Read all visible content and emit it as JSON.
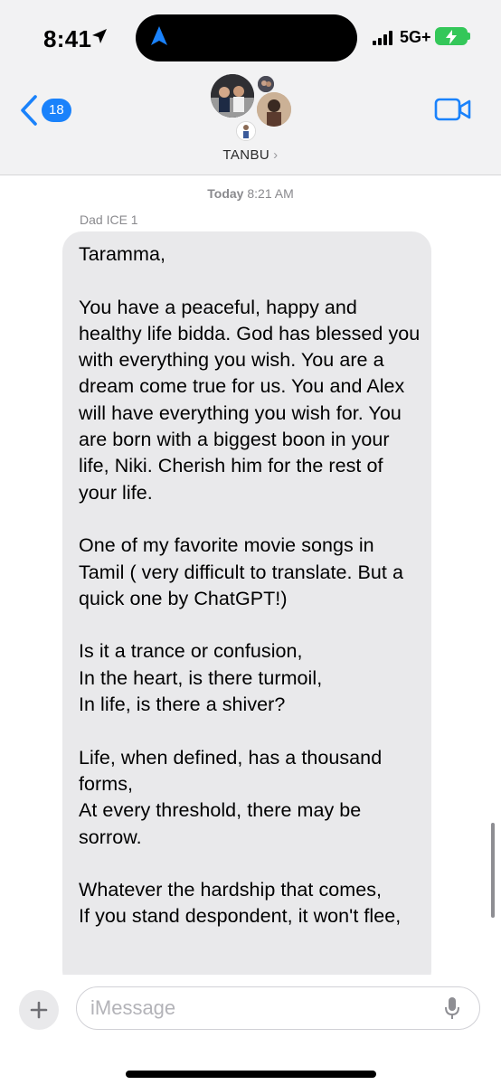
{
  "status_bar": {
    "time": "8:41",
    "network": "5G+"
  },
  "nav": {
    "back_count": "18",
    "group_name": "TANBU",
    "group_chevron": "›"
  },
  "conversation": {
    "timestamp_day": "Today",
    "timestamp_time": "8:21 AM",
    "sender": "Dad ICE 1",
    "message": "Taramma,\n\nYou have a peaceful, happy and healthy life bidda. God has blessed you with everything you wish. You are a dream come true for us.  You and Alex will have everything you wish for. You are born with a biggest boon in your life, Niki. Cherish him for the rest of your life.\n\nOne of my favorite movie songs in Tamil ( very difficult to translate. But a quick one by ChatGPT!)\n\nIs it a trance or confusion,\nIn the heart, is there turmoil,\nIn life, is there a shiver?\n\nLife, when defined, has a thousand forms,\nAt every threshold, there may be sorrow.\n\nWhatever the hardship that comes,\nIf you stand despondent, it won't flee,"
  },
  "composer": {
    "placeholder": "iMessage"
  },
  "icons": {
    "location": "location-arrow-icon",
    "back": "chevron-left-icon",
    "video": "video-camera-icon",
    "add": "plus-icon",
    "mic": "microphone-icon"
  },
  "colors": {
    "accent": "#1a82fb",
    "bubble": "#e9e9eb",
    "battery": "#34c759",
    "header_bg": "#f2f2f3"
  }
}
